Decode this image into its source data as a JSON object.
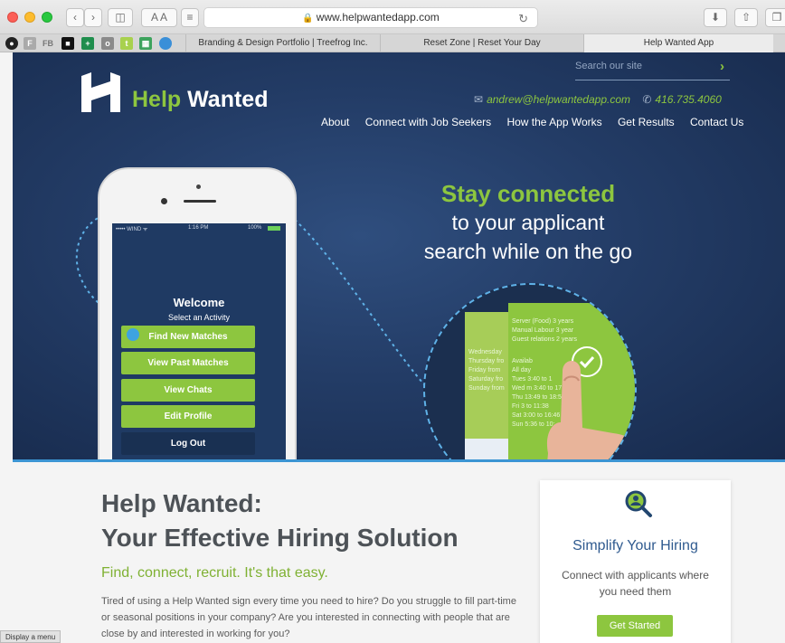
{
  "browser": {
    "url": "www.helpwantedapp.com",
    "reader_label": "A A",
    "bookmarks": [
      "FB"
    ],
    "tabs": [
      "Branding & Design Portfolio | Treefrog Inc.",
      "Reset Zone | Reset Your Day",
      "Help Wanted App"
    ]
  },
  "site": {
    "brand": {
      "word1": "Help",
      "word2": "Wanted"
    },
    "search_placeholder": "Search our site",
    "email": "andrew@helpwantedapp.com",
    "phone": "416.735.4060",
    "nav": [
      "About",
      "Connect with Job Seekers",
      "How the App Works",
      "Get Results",
      "Contact Us"
    ],
    "accent": "#8dc63f",
    "hero_bg": "#233c66"
  },
  "hero": {
    "line1": "Stay connected",
    "line2": "to your applicant",
    "line3": "search while on the go"
  },
  "app": {
    "status_left": "••••• WIND ᯤ",
    "status_time": "1:16 PM",
    "status_right": "100%",
    "welcome": "Welcome",
    "subtitle": "Select an Activity",
    "buttons": [
      "Find New Matches",
      "View Past Matches",
      "View Chats",
      "Edit Profile",
      "Log Out"
    ]
  },
  "card_text": {
    "back": [
      "Server (Food) 3 years",
      "Manual Labour 3 year",
      "Guest relations 2 years"
    ],
    "schedule_left": [
      "Wednesday",
      "Thursday fro",
      "Friday from",
      "Saturday fro",
      "Sunday from"
    ],
    "schedule_right": [
      "Availab",
      "All day",
      "Tues   3:40 to 1",
      "Wed   m 3:40 to 17:44",
      "Thu   13:49 to 18:50",
      "Fri   3 to 11:38",
      "Sat   3:00 to 16:46",
      "Sun   5:36 to 10:"
    ]
  },
  "content": {
    "title1": "Help Wanted:",
    "title2": "Your Effective Hiring Solution",
    "tagline": "Find, connect, recruit.  It's that easy.",
    "paragraph": "Tired of using a Help Wanted sign every time you need to hire? Do you struggle to fill part-time or seasonal positions in your company? Are you interested in connecting with people that are close by and interested in working for you?"
  },
  "sidebar_card": {
    "title": "Simplify Your Hiring",
    "description": "Connect with applicants where you need them",
    "button": "Get Started"
  },
  "tooltip": "Display a menu"
}
